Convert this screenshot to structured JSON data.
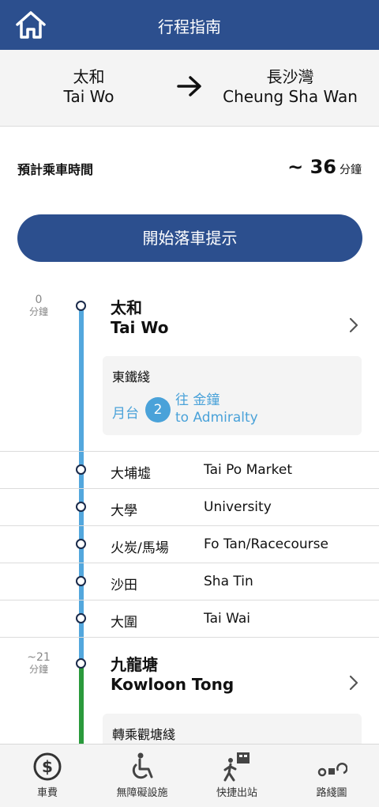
{
  "header": {
    "title": "行程指南",
    "home_icon": "home-icon"
  },
  "route": {
    "from_zh": "太和",
    "from_en": "Tai Wo",
    "to_zh": "長沙灣",
    "to_en": "Cheung Sha Wan",
    "arrow_icon": "arrow-right-icon"
  },
  "estimate": {
    "label": "預計乘車時間",
    "prefix": "~",
    "value": "36",
    "unit": "分鐘"
  },
  "start_button": {
    "label": "開始落車提示"
  },
  "journey": {
    "line_colors": {
      "east_rail": "#53a7dd",
      "kwun_tong": "#2a9a3c"
    },
    "first": {
      "time_value": "0",
      "time_unit": "分鐘",
      "name_zh": "太和",
      "name_en": "Tai Wo",
      "line_name": "東鐵綫",
      "platform_label": "月台",
      "platform_number": "2",
      "dest_zh": "往 金鐘",
      "dest_en": "to Admiralty"
    },
    "stops": [
      {
        "zh": "大埔墟",
        "en": "Tai Po Market"
      },
      {
        "zh": "大學",
        "en": "University"
      },
      {
        "zh": "火炭/馬場",
        "en": "Fo Tan/Racecourse"
      },
      {
        "zh": "沙田",
        "en": "Sha Tin"
      },
      {
        "zh": "大圍",
        "en": "Tai Wai"
      }
    ],
    "transfer": {
      "time_value": "~21",
      "time_unit": "分鐘",
      "name_zh": "九龍塘",
      "name_en": "Kowloon Tong",
      "line_name": "轉乘觀塘綫"
    }
  },
  "bottom_nav": [
    {
      "label": "車費",
      "icon": "dollar-icon"
    },
    {
      "label": "無障礙設施",
      "icon": "wheelchair-icon"
    },
    {
      "label": "快捷出站",
      "icon": "exit-icon"
    },
    {
      "label": "路綫圖",
      "icon": "route-map-icon"
    }
  ]
}
